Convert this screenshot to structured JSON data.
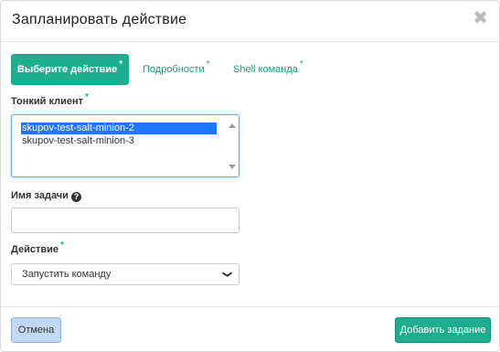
{
  "dialog": {
    "title": "Запланировать действие",
    "close_glyph": "✖"
  },
  "tabs": [
    {
      "label": "Выберите действие",
      "required": "*",
      "active": true
    },
    {
      "label": "Подробности",
      "required": "*",
      "active": false
    },
    {
      "label": "Shell команда",
      "required": "*",
      "active": false
    }
  ],
  "fields": {
    "thin_client": {
      "label": "Тонкий клиент",
      "required": "*",
      "options": [
        "skupov-test-salt-minion-2",
        "skupov-test-salt-minion-3"
      ],
      "selected": "skupov-test-salt-minion-2"
    },
    "task_name": {
      "label": "Имя задачи",
      "help_icon": "?",
      "value": ""
    },
    "action": {
      "label": "Действие",
      "required": "*",
      "selected": "Запустить команду"
    }
  },
  "buttons": {
    "cancel": "Отмена",
    "submit": "Добавить задание"
  },
  "icons": {
    "close": "close-icon",
    "help": "question-circle-icon",
    "select_arrow": "chevron-down-icon"
  },
  "colors": {
    "accent": "#1eae8f",
    "selection": "#1e78ff",
    "cancel_bg": "#c2d9f5"
  }
}
